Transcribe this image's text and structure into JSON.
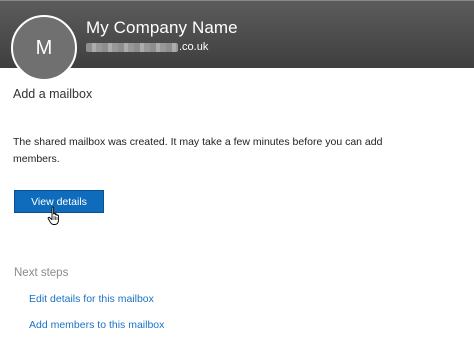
{
  "header": {
    "avatar_initial": "M",
    "company_name": "My Company Name",
    "domain_suffix": ".co.uk",
    "background_color": "#4a4a4a"
  },
  "page": {
    "title": "Add a mailbox",
    "message": "The shared mailbox was created. It may take a few minutes before you can add members."
  },
  "primary_button": {
    "label": "View details",
    "color": "#0f6cbd"
  },
  "next_steps": {
    "heading": "Next steps",
    "links": [
      {
        "label": "Edit details for this mailbox"
      },
      {
        "label": "Add members to this mailbox"
      }
    ],
    "link_color": "#1a73c7"
  },
  "icons": {
    "cursor": "hand-pointer-icon"
  }
}
